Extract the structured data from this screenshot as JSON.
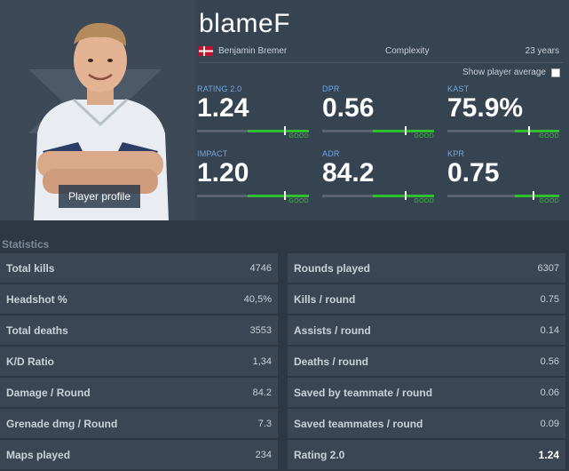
{
  "profile": {
    "nickname": "blameF",
    "real_name": "Benjamin Bremer",
    "team": "Complexity",
    "age": "23 years",
    "profile_button": "Player profile",
    "show_average_label": "Show player average"
  },
  "summary_stats": [
    {
      "label": "RATING 2.0",
      "value": "1.24",
      "bar_fill_percent": 55,
      "marker_percent": 78,
      "tag": "GOOD"
    },
    {
      "label": "DPR",
      "value": "0.56",
      "bar_fill_percent": 55,
      "marker_percent": 74,
      "tag": "GOOD"
    },
    {
      "label": "KAST",
      "value": "75.9%",
      "bar_fill_percent": 40,
      "marker_percent": 72,
      "tag": "GOOD"
    },
    {
      "label": "IMPACT",
      "value": "1.20",
      "bar_fill_percent": 55,
      "marker_percent": 78,
      "tag": "GOOD"
    },
    {
      "label": "ADR",
      "value": "84.2",
      "bar_fill_percent": 55,
      "marker_percent": 74,
      "tag": "GOOD"
    },
    {
      "label": "KPR",
      "value": "0.75",
      "bar_fill_percent": 40,
      "marker_percent": 76,
      "tag": "GOOD"
    }
  ],
  "statistics": {
    "title": "Statistics",
    "left": [
      {
        "label": "Total kills",
        "value": "4746"
      },
      {
        "label": "Headshot %",
        "value": "40,5%"
      },
      {
        "label": "Total deaths",
        "value": "3553"
      },
      {
        "label": "K/D Ratio",
        "value": "1,34"
      },
      {
        "label": "Damage / Round",
        "value": "84.2"
      },
      {
        "label": "Grenade dmg / Round",
        "value": "7.3"
      },
      {
        "label": "Maps played",
        "value": "234"
      }
    ],
    "right": [
      {
        "label": "Rounds played",
        "value": "6307"
      },
      {
        "label": "Kills / round",
        "value": "0.75"
      },
      {
        "label": "Assists / round",
        "value": "0.14"
      },
      {
        "label": "Deaths / round",
        "value": "0.56"
      },
      {
        "label": "Saved by teammate / round",
        "value": "0.06"
      },
      {
        "label": "Saved teammates / round",
        "value": "0.09"
      },
      {
        "label": "Rating 2.0",
        "value": "1.24"
      }
    ]
  },
  "colors": {
    "accent_label": "#6ea8e8",
    "good": "#2fbf2f"
  }
}
